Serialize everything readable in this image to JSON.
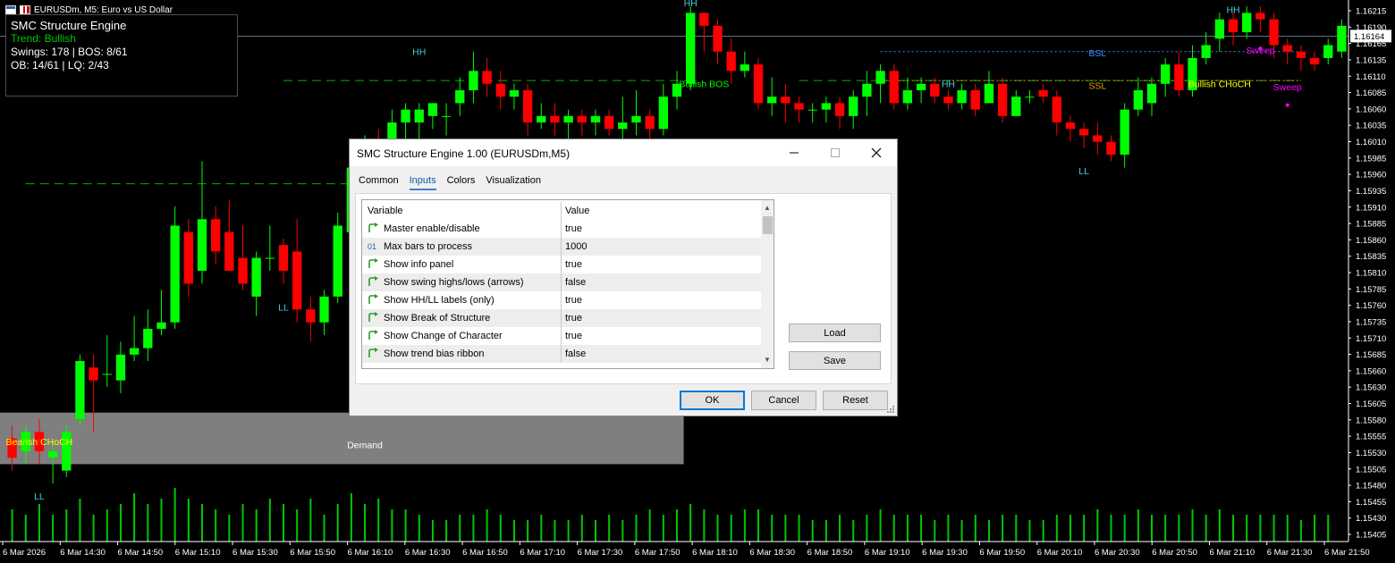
{
  "symbol_header": {
    "title": "EURUSDm, M5:  Euro vs US Dollar"
  },
  "info_panel": {
    "title": "SMC Structure Engine",
    "trend": "Trend: Bullish",
    "swings": "Swings: 178 | BOS: 8/61",
    "ob_lq": "OB: 14/61 | LQ: 2/43",
    "colors": {
      "title": "#ffffff",
      "trend": "#00c800",
      "stats": "#ffffff"
    }
  },
  "colors": {
    "bull": "#00ff00",
    "bear": "#ff0000",
    "demand_zone": "#7f7f7f",
    "structure_line": "#00b000",
    "hh_ll_label": "#3fd0e0",
    "bos_label": "#00ff00",
    "choch_label": "#ffff00",
    "bsl": "#3a8aff",
    "ssl": "#e5a000",
    "sweep": "#ff00ff",
    "volume": "#00c800",
    "price_line": "#8296b4"
  },
  "chart_data": {
    "type": "candlestick",
    "symbol": "EURUSDm",
    "timeframe": "M5",
    "ylim": [
      1.1538,
      1.1622
    ],
    "y_ticks": [
      "1.16215",
      "1.16190",
      "1.16165",
      "1.16135",
      "1.16110",
      "1.16085",
      "1.16060",
      "1.16035",
      "1.16010",
      "1.15985",
      "1.15960",
      "1.15935",
      "1.15910",
      "1.15885",
      "1.15860",
      "1.15835",
      "1.15810",
      "1.15785",
      "1.15760",
      "1.15735",
      "1.15710",
      "1.15685",
      "1.15660",
      "1.15630",
      "1.15605",
      "1.15580",
      "1.15555",
      "1.15530",
      "1.15505",
      "1.15480",
      "1.15455",
      "1.15430",
      "1.15405"
    ],
    "current_price": "1.16164",
    "x_ticks": [
      "6 Mar 2026",
      "6 Mar 14:30",
      "6 Mar 14:50",
      "6 Mar 15:10",
      "6 Mar 15:30",
      "6 Mar 15:50",
      "6 Mar 16:10",
      "6 Mar 16:30",
      "6 Mar 16:50",
      "6 Mar 17:10",
      "6 Mar 17:30",
      "6 Mar 17:50",
      "6 Mar 18:10",
      "6 Mar 18:30",
      "6 Mar 18:50",
      "6 Mar 19:10",
      "6 Mar 19:30",
      "6 Mar 19:50",
      "6 Mar 20:10",
      "6 Mar 20:30",
      "6 Mar 20:50",
      "6 Mar 21:10",
      "6 Mar 21:30",
      "6 Mar 21:50"
    ],
    "candles": [
      [
        1.1554,
        1.1551,
        1.1556,
        1.1549
      ],
      [
        1.1552,
        1.1555,
        1.1556,
        1.155
      ],
      [
        1.1555,
        1.1552,
        1.1557,
        1.155
      ],
      [
        1.1551,
        1.1552,
        1.1553,
        1.1547
      ],
      [
        1.1549,
        1.1555,
        1.1556,
        1.1548
      ],
      [
        1.1557,
        1.1566,
        1.1567,
        1.1556
      ],
      [
        1.1565,
        1.1563,
        1.1567,
        1.1555
      ],
      [
        1.1564,
        1.1564,
        1.157,
        1.1562
      ],
      [
        1.1563,
        1.1567,
        1.1569,
        1.1561
      ],
      [
        1.1567,
        1.1568,
        1.1573,
        1.1566
      ],
      [
        1.1568,
        1.1571,
        1.1574,
        1.1566
      ],
      [
        1.1571,
        1.1572,
        1.1577,
        1.157
      ],
      [
        1.1572,
        1.1587,
        1.159,
        1.1571
      ],
      [
        1.1586,
        1.1578,
        1.1588,
        1.1576
      ],
      [
        1.158,
        1.1588,
        1.1597,
        1.1578
      ],
      [
        1.1588,
        1.1583,
        1.159,
        1.1581
      ],
      [
        1.1586,
        1.158,
        1.1591,
        1.158
      ],
      [
        1.1582,
        1.1578,
        1.1587,
        1.1577
      ],
      [
        1.1576,
        1.1582,
        1.1583,
        1.1573
      ],
      [
        1.1582,
        1.1582,
        1.1587,
        1.158
      ],
      [
        1.1584,
        1.158,
        1.1585,
        1.1578
      ],
      [
        1.1583,
        1.1574,
        1.1588,
        1.1572
      ],
      [
        1.1574,
        1.1572,
        1.1576,
        1.1569
      ],
      [
        1.1572,
        1.1576,
        1.1577,
        1.157
      ],
      [
        1.1576,
        1.1587,
        1.1589,
        1.1575
      ],
      [
        1.1586,
        1.1596,
        1.1597,
        1.1583
      ],
      [
        1.1596,
        1.1599,
        1.1601,
        1.1592
      ],
      [
        1.1599,
        1.159,
        1.1602,
        1.1588
      ],
      [
        1.159,
        1.1603,
        1.1605,
        1.1588
      ],
      [
        1.1603,
        1.1605,
        1.1606,
        1.1596
      ],
      [
        1.1603,
        1.1605,
        1.1606,
        1.16
      ],
      [
        1.1604,
        1.1606,
        1.1606,
        1.1602
      ],
      [
        1.1604,
        1.1604,
        1.1606,
        1.1601
      ],
      [
        1.1606,
        1.1608,
        1.161,
        1.1604
      ],
      [
        1.1608,
        1.1611,
        1.1614,
        1.1606
      ],
      [
        1.1611,
        1.1609,
        1.1613,
        1.1607
      ],
      [
        1.1609,
        1.1607,
        1.1611,
        1.1605
      ],
      [
        1.1607,
        1.1608,
        1.1609,
        1.1605
      ],
      [
        1.1608,
        1.1603,
        1.1609,
        1.1601
      ],
      [
        1.1603,
        1.1604,
        1.1606,
        1.1602
      ],
      [
        1.1604,
        1.1603,
        1.1606,
        1.1601
      ],
      [
        1.1603,
        1.1604,
        1.1605,
        1.16
      ],
      [
        1.1604,
        1.1603,
        1.1605,
        1.1601
      ],
      [
        1.1603,
        1.1604,
        1.1605,
        1.1601
      ],
      [
        1.1604,
        1.1602,
        1.1605,
        1.1601
      ],
      [
        1.1602,
        1.1603,
        1.1607,
        1.16
      ],
      [
        1.1603,
        1.1604,
        1.1608,
        1.1601
      ],
      [
        1.1604,
        1.1602,
        1.1605,
        1.16
      ],
      [
        1.1602,
        1.1607,
        1.1609,
        1.1601
      ],
      [
        1.1607,
        1.1609,
        1.1611,
        1.1605
      ],
      [
        1.1609,
        1.162,
        1.1621,
        1.1608
      ],
      [
        1.162,
        1.1618,
        1.162,
        1.1614
      ],
      [
        1.1618,
        1.1614,
        1.1619,
        1.1612
      ],
      [
        1.1614,
        1.1611,
        1.1616,
        1.1609
      ],
      [
        1.1611,
        1.1612,
        1.1614,
        1.161
      ],
      [
        1.1612,
        1.1606,
        1.1613,
        1.1605
      ],
      [
        1.1606,
        1.1607,
        1.161,
        1.1604
      ],
      [
        1.1607,
        1.1606,
        1.1609,
        1.1603
      ],
      [
        1.1606,
        1.1605,
        1.1607,
        1.1603
      ],
      [
        1.1605,
        1.1605,
        1.1606,
        1.1603
      ],
      [
        1.1605,
        1.1606,
        1.1607,
        1.1603
      ],
      [
        1.1606,
        1.1604,
        1.1607,
        1.1602
      ],
      [
        1.1604,
        1.1607,
        1.1608,
        1.1602
      ],
      [
        1.1607,
        1.1609,
        1.1611,
        1.1604
      ],
      [
        1.1609,
        1.1611,
        1.1612,
        1.1606
      ],
      [
        1.1611,
        1.1606,
        1.1612,
        1.1605
      ],
      [
        1.1606,
        1.1608,
        1.161,
        1.1605
      ],
      [
        1.1608,
        1.1609,
        1.161,
        1.1606
      ],
      [
        1.1609,
        1.1607,
        1.161,
        1.1606
      ],
      [
        1.1607,
        1.1606,
        1.1608,
        1.1605
      ],
      [
        1.1606,
        1.1608,
        1.1609,
        1.1605
      ],
      [
        1.1608,
        1.1605,
        1.1609,
        1.1604
      ],
      [
        1.1606,
        1.1609,
        1.1611,
        1.1606
      ],
      [
        1.1609,
        1.1604,
        1.161,
        1.1603
      ],
      [
        1.1604,
        1.1607,
        1.1608,
        1.1604
      ],
      [
        1.1607,
        1.1607,
        1.1608,
        1.1606
      ],
      [
        1.1608,
        1.1607,
        1.1609,
        1.1606
      ],
      [
        1.1607,
        1.1603,
        1.1608,
        1.1601
      ],
      [
        1.1603,
        1.1602,
        1.1604,
        1.16
      ],
      [
        1.1602,
        1.1601,
        1.1603,
        1.1599
      ],
      [
        1.1601,
        1.16,
        1.1603,
        1.1598
      ],
      [
        1.16,
        1.1598,
        1.1601,
        1.1597
      ],
      [
        1.1598,
        1.1605,
        1.1606,
        1.1596
      ],
      [
        1.1605,
        1.1608,
        1.161,
        1.1604
      ],
      [
        1.1606,
        1.1609,
        1.161,
        1.1604
      ],
      [
        1.1609,
        1.1612,
        1.1613,
        1.1607
      ],
      [
        1.1612,
        1.1608,
        1.1614,
        1.1607
      ],
      [
        1.1608,
        1.1613,
        1.1615,
        1.1607
      ],
      [
        1.1613,
        1.1615,
        1.1617,
        1.1612
      ],
      [
        1.1616,
        1.1619,
        1.162,
        1.1614
      ],
      [
        1.1619,
        1.1617,
        1.162,
        1.1615
      ],
      [
        1.1617,
        1.162,
        1.1621,
        1.1616
      ],
      [
        1.162,
        1.1619,
        1.1621,
        1.1617
      ],
      [
        1.1619,
        1.1615,
        1.162,
        1.1613
      ],
      [
        1.1615,
        1.1614,
        1.1616,
        1.1612
      ],
      [
        1.1614,
        1.1613,
        1.1615,
        1.1611
      ],
      [
        1.1613,
        1.1612,
        1.1614,
        1.1611
      ],
      [
        1.1613,
        1.1615,
        1.1616,
        1.1612
      ],
      [
        1.1614,
        1.1618,
        1.1619,
        1.1613
      ]
    ],
    "annotations": [
      {
        "text": "HH",
        "price": 1.1621,
        "candle": 50,
        "color_key": "hh_ll_label"
      },
      {
        "text": "HH",
        "price": 1.16135,
        "candle": 30,
        "color_key": "hh_ll_label"
      },
      {
        "text": "HH",
        "price": 1.16085,
        "candle": 69,
        "color_key": "hh_ll_label"
      },
      {
        "text": "HH",
        "price": 1.162,
        "candle": 90,
        "color_key": "hh_ll_label"
      },
      {
        "text": "LL",
        "price": 1.15738,
        "candle": 20,
        "color_key": "hh_ll_label"
      },
      {
        "text": "LL",
        "price": 1.15445,
        "candle": 2,
        "color_key": "hh_ll_label"
      },
      {
        "text": "LL",
        "price": 1.1595,
        "candle": 79,
        "color_key": "hh_ll_label"
      },
      {
        "text": "Bullish BOS",
        "price": 1.16085,
        "candle": 51,
        "color_key": "bos_label"
      },
      {
        "text": "Bearish CHoCH",
        "price": 1.1553,
        "candle": 2,
        "color_key": "choch_label"
      },
      {
        "text": "Bullish CHoCH",
        "price": 1.16085,
        "candle": 89,
        "color_key": "choch_label"
      },
      {
        "text": "BSL",
        "price": 1.16133,
        "candle": 80,
        "color_key": "bsl"
      },
      {
        "text": "SSL",
        "price": 1.16082,
        "candle": 80,
        "color_key": "ssl"
      },
      {
        "text": "Sweep",
        "price": 1.1608,
        "candle": 94,
        "color_key": "sweep"
      },
      {
        "text": "Sweep",
        "price": 1.16137,
        "candle": 92,
        "color_key": "sweep"
      },
      {
        "text": "Demand",
        "price": 1.15525,
        "candle": 26,
        "color_key": "label_white"
      }
    ],
    "structure_levels": [
      {
        "price": 1.15935,
        "from_candle": 1,
        "to_candle": 25,
        "kind": "dashed",
        "color_key": "structure_line"
      },
      {
        "price": 1.16095,
        "from_candle": 20,
        "to_candle": 50,
        "kind": "dashed",
        "color_key": "structure_line"
      },
      {
        "price": 1.16095,
        "from_candle": 58,
        "to_candle": 95,
        "kind": "dashed",
        "color_key": "structure_line"
      },
      {
        "price": 1.1614,
        "from_candle": 64,
        "to_candle": 95,
        "kind": "dotted",
        "color_key": "bsl"
      },
      {
        "price": 1.16095,
        "from_candle": 64,
        "to_candle": 95,
        "kind": "dotted",
        "color_key": "ssl"
      }
    ],
    "demand_zone": {
      "from_candle": 0,
      "to_candle": 50,
      "top": 1.1558,
      "bottom": 1.155
    },
    "volumes": [
      0.6,
      0.5,
      0.7,
      0.5,
      0.6,
      0.8,
      0.5,
      0.6,
      0.7,
      0.9,
      0.7,
      0.8,
      1.0,
      0.8,
      0.7,
      0.6,
      0.5,
      0.7,
      0.6,
      0.8,
      0.7,
      0.6,
      0.8,
      0.5,
      0.7,
      0.9,
      0.7,
      0.8,
      0.6,
      0.6,
      0.5,
      0.4,
      0.4,
      0.5,
      0.5,
      0.6,
      0.5,
      0.4,
      0.4,
      0.5,
      0.4,
      0.4,
      0.5,
      0.4,
      0.5,
      0.4,
      0.5,
      0.6,
      0.5,
      0.6,
      0.7,
      0.6,
      0.5,
      0.5,
      0.6,
      0.6,
      0.5,
      0.5,
      0.5,
      0.4,
      0.4,
      0.5,
      0.4,
      0.5,
      0.6,
      0.5,
      0.5,
      0.5,
      0.4,
      0.5,
      0.4,
      0.5,
      0.4,
      0.5,
      0.5,
      0.4,
      0.4,
      0.5,
      0.5,
      0.5,
      0.6,
      0.5,
      0.5,
      0.6,
      0.5,
      0.5,
      0.5,
      0.6,
      0.5,
      0.6,
      0.5,
      0.5,
      0.5,
      0.5,
      0.5,
      0.4,
      0.5,
      0.5
    ]
  },
  "dialog": {
    "title": "SMC Structure Engine 1.00 (EURUSDm,M5)",
    "tabs": [
      "Common",
      "Inputs",
      "Colors",
      "Visualization"
    ],
    "active_tab": "Inputs",
    "columns": {
      "variable": "Variable",
      "value": "Value"
    },
    "rows": [
      {
        "variable": "Master enable/disable",
        "value": "true",
        "icon": "bool-param-icon"
      },
      {
        "variable": "Max bars to process",
        "value": "1000",
        "icon": "int-param-icon",
        "icon_text": "01"
      },
      {
        "variable": "Show info panel",
        "value": "true",
        "icon": "bool-param-icon"
      },
      {
        "variable": "Show swing highs/lows (arrows)",
        "value": "false",
        "icon": "bool-param-icon"
      },
      {
        "variable": "Show HH/LL labels (only)",
        "value": "true",
        "icon": "bool-param-icon"
      },
      {
        "variable": "Show Break of Structure",
        "value": "true",
        "icon": "bool-param-icon"
      },
      {
        "variable": "Show Change of Character",
        "value": "true",
        "icon": "bool-param-icon"
      },
      {
        "variable": "Show trend bias ribbon",
        "value": "false",
        "icon": "bool-param-icon"
      }
    ],
    "buttons": {
      "load": "Load",
      "save": "Save",
      "ok": "OK",
      "cancel": "Cancel",
      "reset": "Reset"
    }
  }
}
